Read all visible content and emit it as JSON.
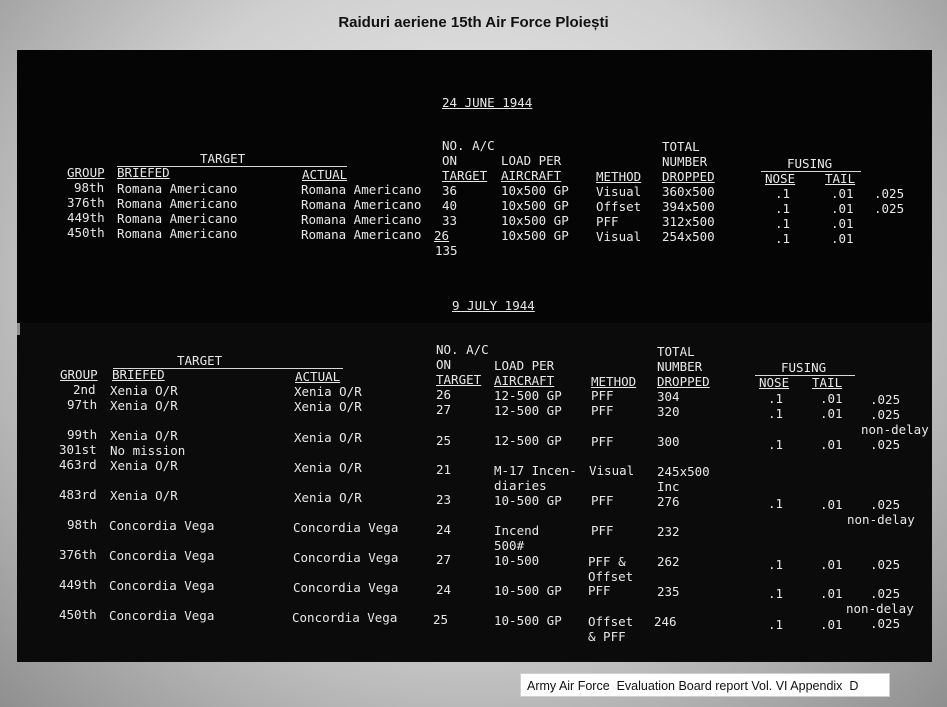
{
  "page": {
    "title": "Raiduri aeriene 15th Air Force Ploiești",
    "caption": "Army Air Force  Evaluation Board report Vol. VI Appendix  D"
  },
  "raid1": {
    "date": "24 JUNE 1944",
    "headers": {
      "target": "TARGET",
      "group": "GROUP",
      "briefed": "BRIEFED",
      "actual": "ACTUAL",
      "no_ac_1": "NO. A/C",
      "no_ac_2": "ON",
      "no_ac_3": "TARGET",
      "load_1": "LOAD PER",
      "load_2": "AIRCRAFT",
      "method": "METHOD",
      "total_1": "TOTAL",
      "total_2": "NUMBER",
      "total_3": "DROPPED",
      "fusing": "FUSING",
      "nose": "NOSE",
      "tail": "TAIL"
    },
    "rows": [
      {
        "group": "98th",
        "briefed": "Romana Americano",
        "actual": "Romana Americano",
        "ac": "36",
        "load": "10x500 GP",
        "method": "Visual",
        "total": "360x500",
        "nose": ".1",
        "tail": ".01",
        "extra": ".025"
      },
      {
        "group": "376th",
        "briefed": "Romana Americano",
        "actual": "Romana Americano",
        "ac": "40",
        "load": "10x500 GP",
        "method": "Offset",
        "total": "394x500",
        "nose": ".1",
        "tail": ".01",
        "extra": ".025"
      },
      {
        "group": "449th",
        "briefed": "Romana Americano",
        "actual": "Romana Americano",
        "ac": "33",
        "load": "10x500 GP",
        "method": "PFF",
        "total": "312x500",
        "nose": ".1",
        "tail": ".01",
        "extra": ""
      },
      {
        "group": "450th",
        "briefed": "Romana Americano",
        "actual": "Romana Americano",
        "ac": "26",
        "load": "10x500 GP",
        "method": "Visual",
        "total": "254x500",
        "nose": ".1",
        "tail": ".01",
        "extra": ""
      }
    ],
    "total_ac": "135"
  },
  "raid2": {
    "date": "9 JULY 1944",
    "headers": {
      "target": "TARGET",
      "group": "GROUP",
      "briefed": "BRIEFED",
      "actual": "ACTUAL",
      "no_ac_1": "NO. A/C",
      "no_ac_2": "ON",
      "no_ac_3": "TARGET",
      "load_1": "LOAD PER",
      "load_2": "AIRCRAFT",
      "method": "METHOD",
      "total_1": "TOTAL",
      "total_2": "NUMBER",
      "total_3": "DROPPED",
      "fusing": "FUSING",
      "nose": "NOSE",
      "tail": "TAIL"
    },
    "rows": [
      {
        "group": "2nd",
        "briefed": "Xenia O/R",
        "actual": "Xenia O/R",
        "ac": "26",
        "load": "12-500 GP",
        "method": "PFF",
        "total": "304",
        "nose": ".1",
        "tail": ".01",
        "extra": ".025"
      },
      {
        "group": "97th",
        "briefed": "Xenia O/R",
        "actual": "Xenia O/R",
        "ac": "27",
        "load": "12-500 GP",
        "method": "PFF",
        "total": "320",
        "nose": ".1",
        "tail": ".01",
        "extra": ".025"
      },
      {
        "note": "non-delay"
      },
      {
        "group": "99th",
        "briefed": "Xenia O/R",
        "actual": "Xenia O/R",
        "ac": "25",
        "load": "12-500 GP",
        "method": "PFF",
        "total": "300",
        "nose": ".1",
        "tail": ".01",
        "extra": ".025"
      },
      {
        "group": "301st",
        "briefed": "No mission"
      },
      {
        "group": "463rd",
        "briefed": "Xenia O/R",
        "actual": "Xenia O/R",
        "ac": "21",
        "load": "M-17 Incen-",
        "load2": "diaries",
        "method": "Visual",
        "total": "245x500",
        "total2": "Inc"
      },
      {
        "group": "483rd",
        "briefed": "Xenia O/R",
        "actual": "Xenia O/R",
        "ac": "23",
        "load": "10-500 GP",
        "method": "PFF",
        "total": "276",
        "nose": ".1",
        "tail": ".01",
        "extra": ".025"
      },
      {
        "note": "non-delay"
      },
      {
        "group": "98th",
        "briefed": "Concordia Vega",
        "actual": "Concordia Vega",
        "ac": "24",
        "load": "Incend",
        "load2": "500#",
        "method": "PFF",
        "total": "232"
      },
      {
        "group": "376th",
        "briefed": "Concordia Vega",
        "actual": "Concordia Vega",
        "ac": "27",
        "load": "10-500",
        "method": "PFF &",
        "method2": "Offset",
        "total": "262",
        "nose": ".1",
        "tail": ".01",
        "extra": ".025"
      },
      {
        "group": "449th",
        "briefed": "Concordia Vega",
        "actual": "Concordia Vega",
        "ac": "24",
        "load": "10-500 GP",
        "method": "PFF",
        "total": "235",
        "nose": ".1",
        "tail": ".01",
        "extra": ".025"
      },
      {
        "note": "non-delay"
      },
      {
        "group": "450th",
        "briefed": "Concordia Vega",
        "actual": "Concordia Vega",
        "ac": "25",
        "load": "10-500 GP",
        "method": "Offset",
        "method2": "& PFF",
        "total": "246",
        "nose": ".1",
        "tail": ".01",
        "extra": ".025"
      }
    ]
  }
}
